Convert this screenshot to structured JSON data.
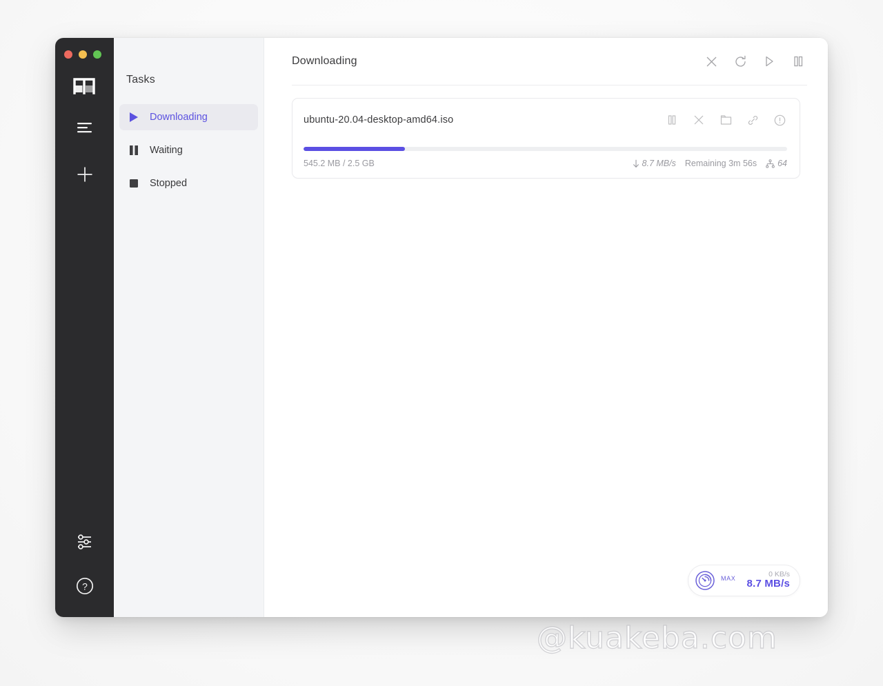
{
  "window": {
    "traffic_lights": [
      {
        "name": "close",
        "color": "#ed6a5f"
      },
      {
        "name": "minimize",
        "color": "#f4bf50"
      },
      {
        "name": "zoom",
        "color": "#62c554"
      }
    ],
    "logo_alt": "m"
  },
  "rail": {
    "items": [
      {
        "icon": "list-icon",
        "label": "List"
      },
      {
        "icon": "plus-icon",
        "label": "Add"
      }
    ],
    "bottom_items": [
      {
        "icon": "sliders-icon",
        "label": "Preferences"
      },
      {
        "icon": "help-circle-icon",
        "label": "Help"
      }
    ]
  },
  "sidebar": {
    "title": "Tasks",
    "items": [
      {
        "id": "downloading",
        "label": "Downloading",
        "icon": "play-icon",
        "active": true
      },
      {
        "id": "waiting",
        "label": "Waiting",
        "icon": "pause-icon",
        "active": false
      },
      {
        "id": "stopped",
        "label": "Stopped",
        "icon": "stop-icon",
        "active": false
      }
    ]
  },
  "main": {
    "title": "Downloading",
    "header_actions": [
      {
        "id": "close",
        "icon": "close-icon",
        "label": "Delete"
      },
      {
        "id": "refresh",
        "icon": "refresh-icon",
        "label": "Refresh"
      },
      {
        "id": "resume",
        "icon": "play-icon",
        "label": "Resume All"
      },
      {
        "id": "pause",
        "icon": "pause-icon",
        "label": "Pause All"
      }
    ]
  },
  "task": {
    "name": "ubuntu-20.04-desktop-amd64.iso",
    "actions": [
      {
        "id": "pause",
        "icon": "pause-icon",
        "label": "Pause"
      },
      {
        "id": "delete",
        "icon": "close-icon",
        "label": "Delete"
      },
      {
        "id": "folder",
        "icon": "folder-icon",
        "label": "Show in folder"
      },
      {
        "id": "link",
        "icon": "link-icon",
        "label": "Copy link"
      },
      {
        "id": "info",
        "icon": "info-icon",
        "label": "Info"
      }
    ],
    "progress_percent": 21,
    "size_text": "545.2 MB / 2.5 GB",
    "downloaded": "545.2 MB",
    "total": "2.5 GB",
    "speed": "8.7 MB/s",
    "remaining": "Remaining 3m 56s",
    "peers": "64",
    "accent_color": "#5b4fe3"
  },
  "speed_pill": {
    "max_label": "MAX",
    "upload_speed": "0 KB/s",
    "download_speed": "8.7 MB/s",
    "gauge_icon": "speedometer-icon"
  },
  "watermark": {
    "text": "@kuakeba.com"
  }
}
